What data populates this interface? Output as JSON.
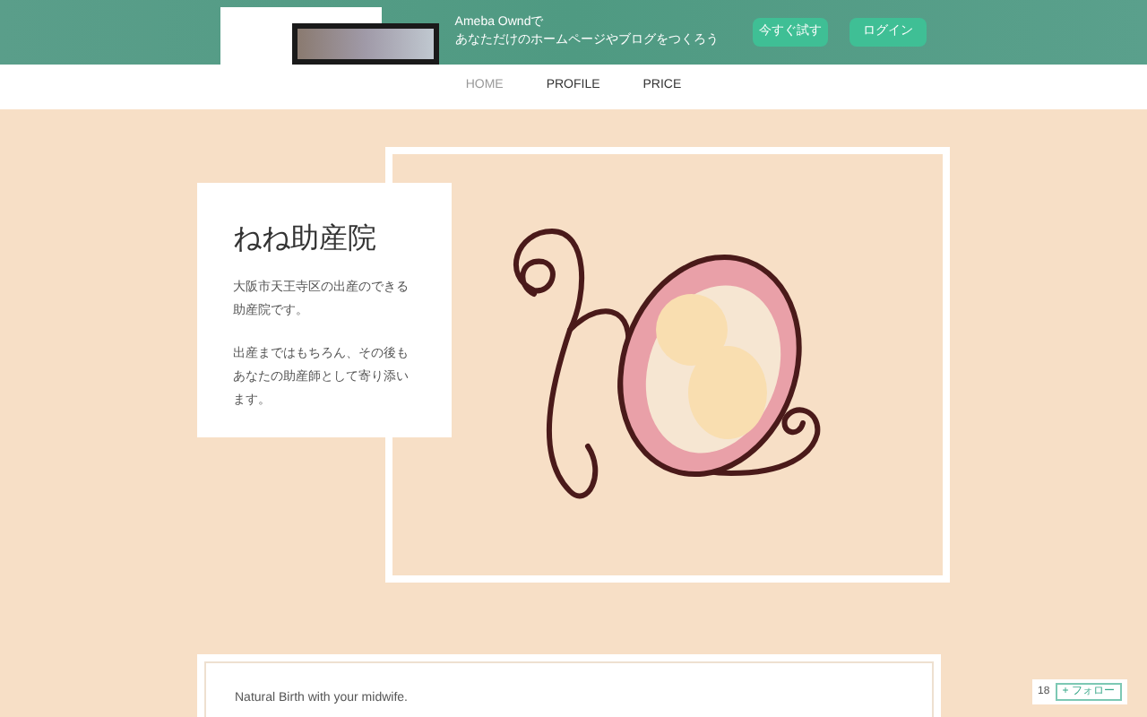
{
  "banner": {
    "line_1": "Ameba Owndで",
    "line_2": "あなただけのホームページやブログをつくろう",
    "buttons": [
      "今すぐ試す",
      "ログイン"
    ]
  },
  "nav": [
    {
      "label": "HOME",
      "selected": true
    },
    {
      "label": "PROFILE",
      "selected": false
    },
    {
      "label": "PRICE",
      "selected": false
    }
  ],
  "intro": {
    "title": "ねね助産院",
    "paragraphs": [
      "大阪市天王寺区の出産のできる助産院です。",
      "出産まではもちろん、その後もあなたの助産師として寄り添います。"
    ]
  },
  "tagline": "Natural Birth with your midwife.",
  "follow": {
    "count": "18",
    "button": "+ フォロー"
  }
}
